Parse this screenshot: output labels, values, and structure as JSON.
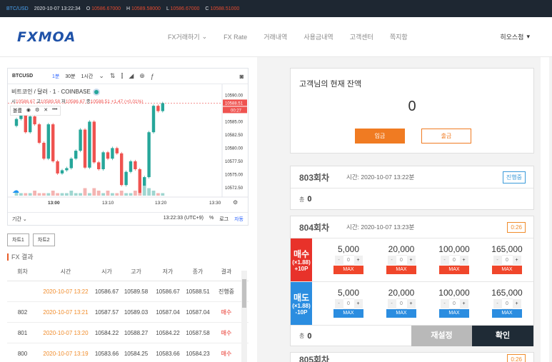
{
  "ticker": {
    "symbol": "BTC/USD",
    "datetime": "2020-10-07 13:22:34",
    "open_label": "O",
    "open": "10586.67000",
    "high_label": "H",
    "high": "10589.58000",
    "low_label": "L",
    "low": "10586.67000",
    "close_label": "C",
    "close": "10588.51000"
  },
  "header": {
    "logo": "FXMOA",
    "nav": [
      "FX거래하기",
      "FX Rate",
      "거래내역",
      "사용금내역",
      "고객센터",
      "쪽지함"
    ],
    "user": "히오스첨"
  },
  "chart": {
    "symbol": "BTCUSD",
    "intervals": [
      "1분",
      "30분",
      "1시간"
    ],
    "title": "비트코인 / 달러 · 1 · COINBASE",
    "ohlc_text": {
      "o_label": "시",
      "o": "10586.67",
      "h_label": "고",
      "h": "10589.58",
      "l_label": "저",
      "l": "10586.67",
      "c_label": "종",
      "c": "10588.51",
      "change": "+1.47 (+0.01%)"
    },
    "legend": [
      "볼륨"
    ],
    "price_labels": [
      "10590.00",
      "10587.50",
      "10585.00",
      "10582.50",
      "10580.00",
      "10577.50",
      "10575.00",
      "10572.50"
    ],
    "last_price": "10588.51",
    "countdown": "00:27",
    "time_labels": [
      "13:00",
      "13:10",
      "13:20",
      "13:30"
    ],
    "bottom_left": "기간",
    "bottom_time": "13:22:33 (UTC+9)",
    "bottom_pct": "%",
    "bottom_log": "로그",
    "bottom_auto": "자동"
  },
  "chart_data": {
    "type": "candlestick",
    "ylim": [
      10571,
      10591
    ],
    "candles": [
      {
        "o": 10584.2,
        "c": 10585.5
      },
      {
        "o": 10585.5,
        "c": 10586.5
      },
      {
        "o": 10586.5,
        "c": 10583.0
      },
      {
        "o": 10583.0,
        "c": 10586.0
      },
      {
        "o": 10586.0,
        "c": 10584.5
      },
      {
        "o": 10584.5,
        "c": 10581.0
      },
      {
        "o": 10581.0,
        "c": 10578.0
      },
      {
        "o": 10578.0,
        "c": 10584.5
      },
      {
        "o": 10584.5,
        "c": 10577.5
      },
      {
        "o": 10577.5,
        "c": 10575.2
      },
      {
        "o": 10575.2,
        "c": 10575.8
      },
      {
        "o": 10575.8,
        "c": 10576.2
      },
      {
        "o": 10576.2,
        "c": 10578.0
      },
      {
        "o": 10578.0,
        "c": 10579.5
      },
      {
        "o": 10579.5,
        "c": 10583.5
      },
      {
        "o": 10583.5,
        "c": 10576.3
      },
      {
        "o": 10576.3,
        "c": 10585.0
      },
      {
        "o": 10585.0,
        "c": 10577.3
      },
      {
        "o": 10577.3,
        "c": 10576.0
      },
      {
        "o": 10576.0,
        "c": 10579.2
      },
      {
        "o": 10579.2,
        "c": 10578.0
      },
      {
        "o": 10578.0,
        "c": 10580.0
      },
      {
        "o": 10580.0,
        "c": 10579.0
      },
      {
        "o": 10579.0,
        "c": 10573.0
      },
      {
        "o": 10573.0,
        "c": 10575.5
      },
      {
        "o": 10575.5,
        "c": 10577.5
      },
      {
        "o": 10577.5,
        "c": 10576.0
      },
      {
        "o": 10576.0,
        "c": 10571.5
      },
      {
        "o": 10571.5,
        "c": 10574.5
      },
      {
        "o": 10574.5,
        "c": 10583.0
      },
      {
        "o": 10583.0,
        "c": 10588.0
      },
      {
        "o": 10588.0,
        "c": 10587.0
      },
      {
        "o": 10587.0,
        "c": 10588.5
      }
    ],
    "volumes": [
      2,
      1,
      1,
      1,
      2,
      1,
      1,
      1,
      2,
      1,
      1,
      1,
      2,
      1,
      1,
      3,
      1,
      3,
      2,
      1,
      2,
      1,
      1,
      2,
      1,
      1,
      2,
      1,
      4,
      3,
      2,
      1,
      1
    ]
  },
  "buttons": {
    "history1": "차트1",
    "history2": "차트2"
  },
  "fx": {
    "title": "FX 결과",
    "headers": [
      "회차",
      "시간",
      "시가",
      "고가",
      "저가",
      "종가",
      "결과"
    ],
    "rows": [
      {
        "round": "",
        "time": "2020-10-07 13:22",
        "open": "10586.67",
        "high": "10589.58",
        "low": "10586.67",
        "close": "10588.51",
        "result": "진행중"
      },
      {
        "round": "802",
        "time": "2020-10-07 13:21",
        "open": "10587.57",
        "high": "10589.03",
        "low": "10587.04",
        "close": "10587.04",
        "result": "매수"
      },
      {
        "round": "801",
        "time": "2020-10-07 13:20",
        "open": "10584.22",
        "high": "10588.27",
        "low": "10584.22",
        "close": "10587.58",
        "result": "매수"
      },
      {
        "round": "800",
        "time": "2020-10-07 13:19",
        "open": "10583.66",
        "high": "10584.25",
        "low": "10583.66",
        "close": "10584.23",
        "result": "매수"
      }
    ]
  },
  "balance": {
    "title": "고객님의 현재 잔액",
    "value": "0",
    "deposit": "입금",
    "withdraw": "출금"
  },
  "round803": {
    "title": "803회차",
    "time": "시간: 2020-10-07 13:22분",
    "badge": "진행중",
    "sum_label": "총",
    "sum": "0"
  },
  "round804": {
    "title": "804회차",
    "time": "시간: 2020-10-07 13:23분",
    "badge": "0:26",
    "buy": {
      "label": "매수",
      "mult": "(×1.88)",
      "pts": "+10P"
    },
    "sell": {
      "label": "매도",
      "mult": "(×1.88)",
      "pts": "-10P"
    },
    "amounts": [
      "5,000",
      "20,000",
      "100,000",
      "165,000"
    ],
    "qty": "0",
    "minus": "-",
    "plus": "+",
    "max": "MAX",
    "sum_label": "총",
    "sum": "0",
    "reset": "재설정",
    "confirm": "확인"
  },
  "round805": {
    "title": "805회차",
    "badge": "0:26"
  }
}
